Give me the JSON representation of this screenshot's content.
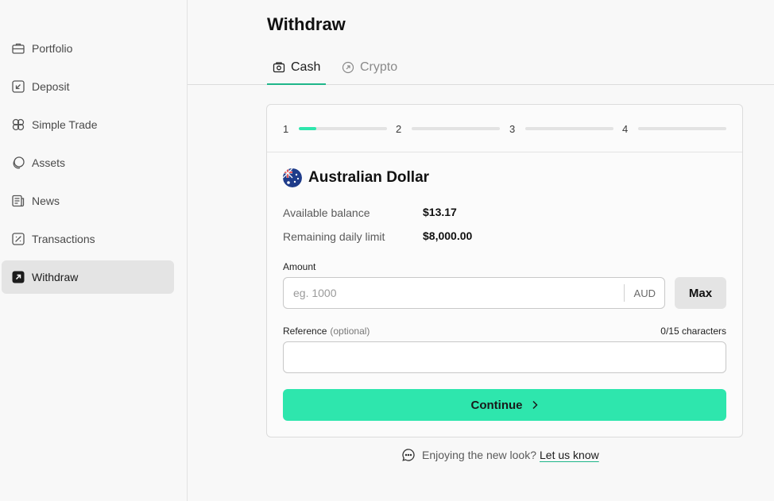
{
  "sidebar": {
    "items": [
      {
        "label": "Portfolio",
        "icon": "briefcase-icon"
      },
      {
        "label": "Deposit",
        "icon": "deposit-arrow-icon"
      },
      {
        "label": "Simple Trade",
        "icon": "simple-trade-icon"
      },
      {
        "label": "Assets",
        "icon": "assets-circles-icon"
      },
      {
        "label": "News",
        "icon": "news-icon"
      },
      {
        "label": "Transactions",
        "icon": "transactions-icon"
      },
      {
        "label": "Withdraw",
        "icon": "withdraw-arrow-icon",
        "active": true
      }
    ]
  },
  "header": {
    "title": "Withdraw",
    "tabs": [
      {
        "label": "Cash",
        "icon": "cash-icon",
        "active": true
      },
      {
        "label": "Crypto",
        "icon": "crypto-icon",
        "active": false
      }
    ]
  },
  "steps": {
    "items": [
      "1",
      "2",
      "3",
      "4"
    ],
    "current": 1,
    "current_progress": 0.2
  },
  "currency": {
    "name": "Australian Dollar",
    "flag_icon": "australia-flag-icon"
  },
  "balance": {
    "available_label": "Available balance",
    "available_value": "$13.17",
    "limit_label": "Remaining daily limit",
    "limit_value": "$8,000.00"
  },
  "amount": {
    "label": "Amount",
    "placeholder": "eg. 1000",
    "value": "",
    "unit": "AUD",
    "max_label": "Max"
  },
  "reference": {
    "label": "Reference",
    "optional_label": "(optional)",
    "char_count": "0/15 characters",
    "value": ""
  },
  "continue_label": "Continue",
  "feedback": {
    "text": "Enjoying the new look?",
    "link": "Let us know"
  },
  "colors": {
    "accent": "#2ee6ad",
    "tab_underline": "#1fb68a",
    "active_nav_bg": "#e4e4e4"
  }
}
